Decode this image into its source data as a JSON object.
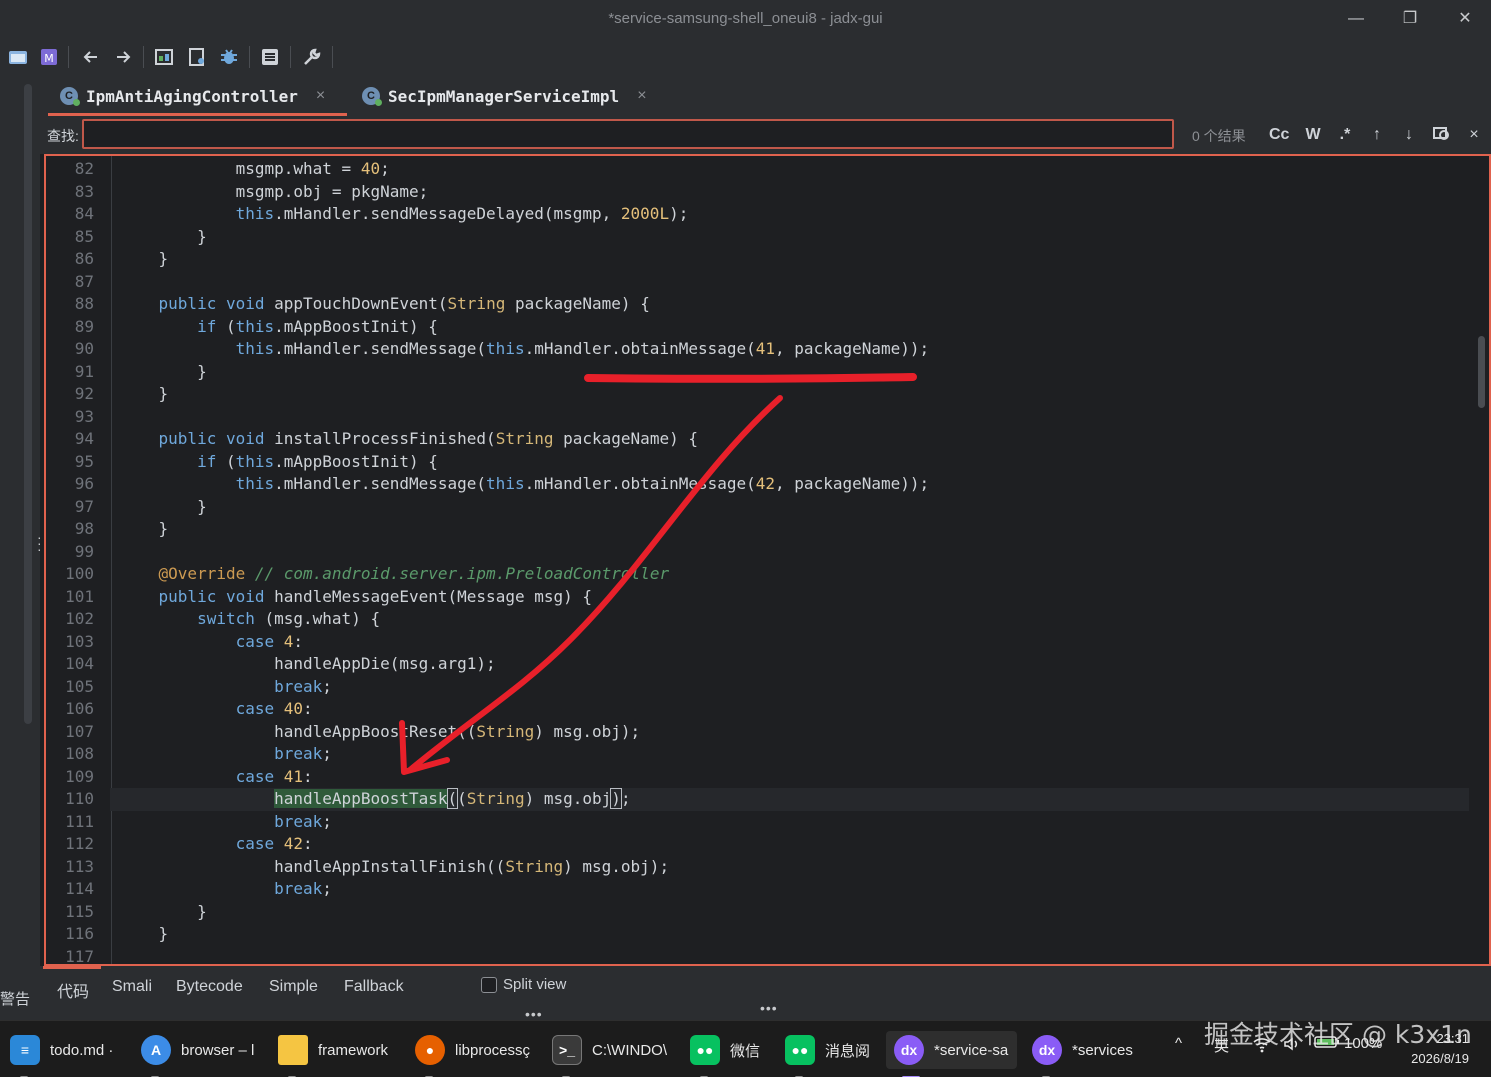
{
  "window": {
    "title": "*service-samsung-shell_oneui8 - jadx-gui",
    "minimize": "—",
    "restore": "❐",
    "close": "✕"
  },
  "tabs": [
    {
      "label": "IpmAntiAgingController",
      "icon": "C",
      "close": "×",
      "active": true
    },
    {
      "label": "SecIpmManagerServiceImpl",
      "icon": "C",
      "close": "×",
      "active": false
    }
  ],
  "search": {
    "label": "查找:",
    "value": "",
    "count": "0 个结果",
    "case_btn": "Cc",
    "word_btn": "W",
    "regex_btn": ".*",
    "up_btn": "↑",
    "down_btn": "↓",
    "close_btn": "×"
  },
  "code": {
    "line_numbers": [
      "82",
      "83",
      "84",
      "85",
      "86",
      "87",
      "88",
      "89",
      "90",
      "91",
      "92",
      "93",
      "94",
      "95",
      "96",
      "97",
      "98",
      "99",
      "100",
      "101",
      "102",
      "103",
      "104",
      "105",
      "106",
      "107",
      "108",
      "109",
      "110",
      "111",
      "112",
      "113",
      "114",
      "115",
      "116",
      "117"
    ],
    "t": {
      "l82a": "            msgmp.what = ",
      "l82b": "40",
      "l82c": ";",
      "l83": "            msgmp.obj = pkgName;",
      "l84a": "            ",
      "l84b": "this",
      "l84c": ".mHandler.sendMessageDelayed(msgmp, ",
      "l84d": "2000L",
      "l84e": ");",
      "l85": "        }",
      "l86": "    }",
      "l88a": "    ",
      "l88b": "public void",
      "l88c": " appTouchDownEvent(",
      "l88d": "String",
      "l88e": " packageName) {",
      "l89a": "        ",
      "l89b": "if",
      "l89c": " (",
      "l89d": "this",
      "l89e": ".mAppBoostInit) {",
      "l90a": "            ",
      "l90b": "this",
      "l90c": ".mHandler.sendMessage(",
      "l90d": "this",
      "l90e": ".mHandler.obtainMessage(",
      "l90f": "41",
      "l90g": ", packageName));",
      "l91": "        }",
      "l92": "    }",
      "l94a": "    ",
      "l94b": "public void",
      "l94c": " installProcessFinished(",
      "l94d": "String",
      "l94e": " packageName) {",
      "l95a": "        ",
      "l95b": "if",
      "l95c": " (",
      "l95d": "this",
      "l95e": ".mAppBoostInit) {",
      "l96a": "            ",
      "l96b": "this",
      "l96c": ".mHandler.sendMessage(",
      "l96d": "this",
      "l96e": ".mHandler.obtainMessage(",
      "l96f": "42",
      "l96g": ", packageName));",
      "l97": "        }",
      "l98": "    }",
      "l100a": "    ",
      "l100b": "@Override",
      "l100c": " // com.android.server.ipm.PreloadController",
      "l101a": "    ",
      "l101b": "public void",
      "l101c": " handleMessageEvent(Message msg) {",
      "l102a": "        ",
      "l102b": "switch",
      "l102c": " (msg.what) {",
      "l103a": "            ",
      "l103b": "case",
      "l103c": " ",
      "l103d": "4",
      "l103e": ":",
      "l104": "                handleAppDie(msg.arg1);",
      "l105a": "                ",
      "l105b": "break",
      "l105c": ";",
      "l106a": "            ",
      "l106b": "case",
      "l106c": " ",
      "l106d": "40",
      "l106e": ":",
      "l107a": "                handleAppBoostReset((",
      "l107b": "String",
      "l107c": ") msg.obj);",
      "l108a": "                ",
      "l108b": "break",
      "l108c": ";",
      "l109a": "            ",
      "l109b": "case",
      "l109c": " ",
      "l109d": "41",
      "l109e": ":",
      "l110a": "                ",
      "l110b": "handleAppBoostTask",
      "l110c": "(",
      "l110d": "(",
      "l110e": "String",
      "l110f": ") msg.obj",
      "l110g": ")",
      "l110h": ";",
      "l111a": "                ",
      "l111b": "break",
      "l111c": ";",
      "l112a": "            ",
      "l112b": "case",
      "l112c": " ",
      "l112d": "42",
      "l112e": ":",
      "l113a": "                handleAppInstallFinish((",
      "l113b": "String",
      "l113c": ") msg.obj);",
      "l114a": "                ",
      "l114b": "break",
      "l114c": ";",
      "l115": "        }",
      "l116": "    }"
    }
  },
  "bottom_tabs": {
    "warnings": "警告",
    "code": "代码",
    "smali": "Smali",
    "bytecode": "Bytecode",
    "simple": "Simple",
    "fallback": "Fallback",
    "split_view": "Split view"
  },
  "taskbar": {
    "items": [
      {
        "label": "todo.md ·",
        "icon": "notepad-icon",
        "color": "#2b88d8"
      },
      {
        "label": "browser – l",
        "icon": "browser-icon",
        "color": "#3c8ce7"
      },
      {
        "label": "framework",
        "icon": "folder-icon",
        "color": "#f5c542"
      },
      {
        "label": "libprocessç",
        "icon": "firefox-icon",
        "color": "#e66000"
      },
      {
        "label": "C:\\WINDO\\",
        "icon": "terminal-icon",
        "color": "#3a3a3a"
      },
      {
        "label": "微信",
        "icon": "wechat-icon",
        "color": "#07c160"
      },
      {
        "label": "消息阅",
        "icon": "wechat-icon",
        "color": "#07c160"
      },
      {
        "label": "*service-sa",
        "icon": "jadx-icon",
        "color": "#8a5cf6"
      },
      {
        "label": "*services",
        "icon": "jadx-icon",
        "color": "#8a5cf6"
      }
    ],
    "tray_chevron": "^",
    "ime": "英",
    "battery": "100%",
    "time": "23:31",
    "date": "2026/8/19",
    "watermark": "掘金技术社区 @ k3x1n"
  },
  "colors": {
    "keyword": "#6fa8dc",
    "type": "#d5b778",
    "number": "#e5c07b",
    "annotation": "#cc9a52",
    "comment": "#5b9a6b",
    "accent_border": "#e0624e",
    "annotation_stroke": "#e8202a"
  }
}
